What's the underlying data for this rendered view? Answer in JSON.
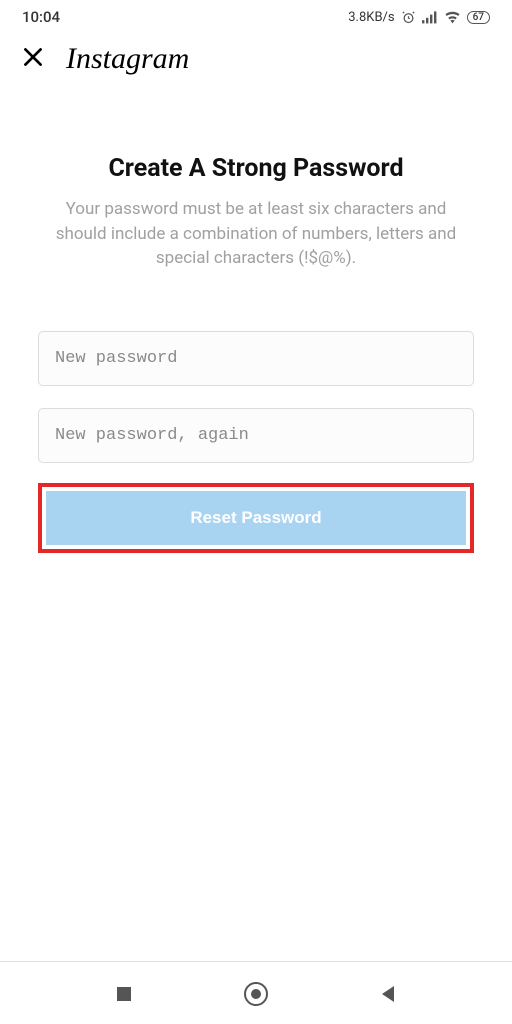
{
  "status_bar": {
    "time": "10:04",
    "network_speed": "3.8KB/s",
    "battery": "67"
  },
  "header": {
    "app_name": "Instagram"
  },
  "main": {
    "title": "Create A Strong Password",
    "subtitle": "Your password must be at least six characters and should include a combination of numbers, letters and special characters (!$@%).",
    "new_password_placeholder": "New password",
    "new_password_again_placeholder": "New password, again",
    "reset_button_label": "Reset Password"
  },
  "colors": {
    "highlight": "#e22828",
    "button_bg": "#a8d4f2",
    "subtitle_text": "#a0a0a0"
  }
}
